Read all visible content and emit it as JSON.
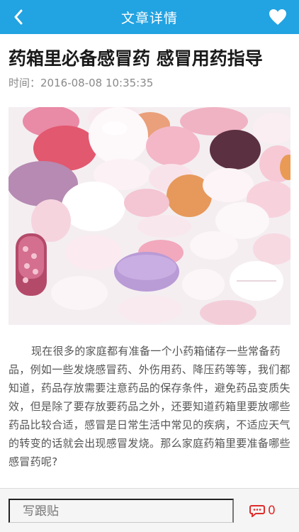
{
  "header": {
    "title": "文章详情",
    "back_icon": "chevron-left-icon",
    "favorite_icon": "heart-icon",
    "bar_color": "#22a3e2"
  },
  "article": {
    "title": "药箱里必备感冒药 感冒用药指导",
    "time_label": "时间：",
    "time_value": "2016-08-08 10:35:35",
    "image": "pills-photo",
    "body": "现在很多的家庭都有准备一个小药箱储存一些常备药品，例如一些发烧感冒药、外伤用药、降压药等等，我们都知道，药品存放需要注意药品的保存条件，避免药品变质失效，但是除了要存放要药品之外，还要知道药箱里要放哪些药品比较合适，感冒是日常生活中常见的疾病，不适应天气的转变的话就会出现感冒发烧。那么家庭药箱里要准备哪些感冒药呢?"
  },
  "footer": {
    "reply_placeholder": "写跟贴",
    "comment_icon": "comment-bubble-icon",
    "comment_count": "0",
    "comment_color": "#e02b2b"
  }
}
